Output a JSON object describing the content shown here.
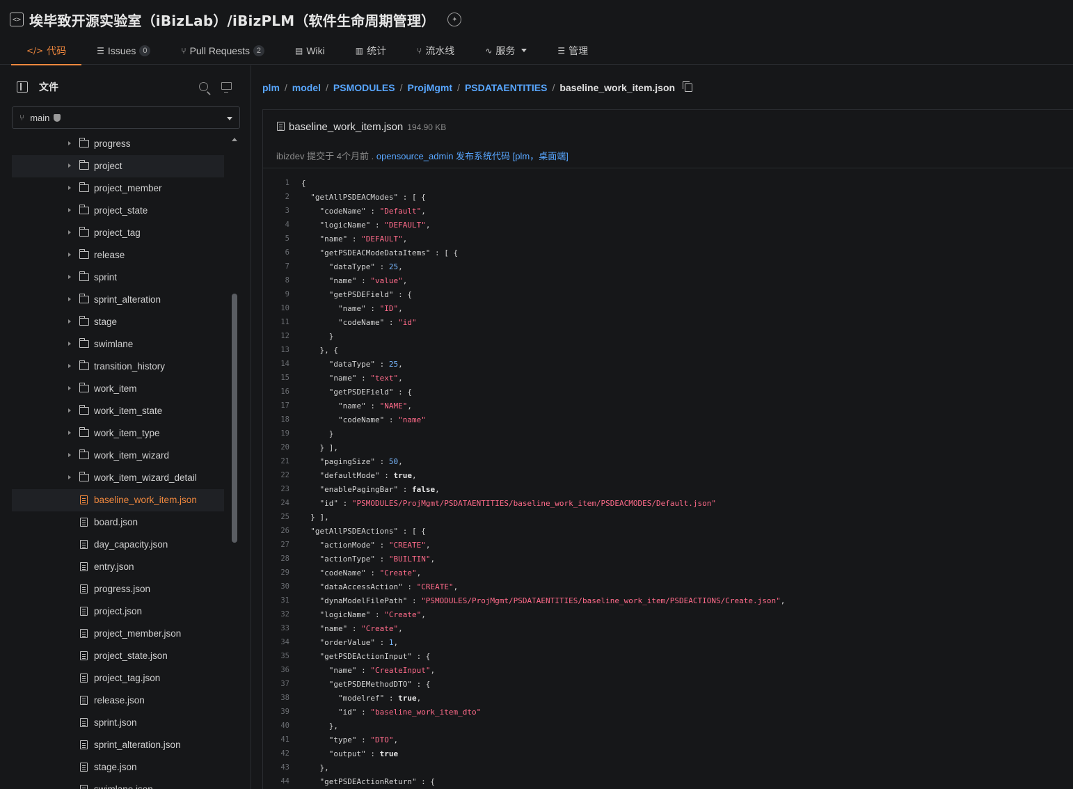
{
  "header": {
    "title": "埃毕致开源实验室（iBizLab）/iBizPLM（软件生命周期管理）",
    "tabs": [
      {
        "icon": "</>",
        "label": "代码",
        "count": ""
      },
      {
        "icon": "☰",
        "label": "Issues",
        "count": "0"
      },
      {
        "icon": "⑂",
        "label": "Pull Requests",
        "count": "2"
      },
      {
        "icon": "▤",
        "label": "Wiki",
        "count": ""
      },
      {
        "icon": "▥",
        "label": "统计",
        "count": ""
      },
      {
        "icon": "⑂",
        "label": "流水线",
        "count": ""
      },
      {
        "icon": "∿",
        "label": "服务",
        "count": ""
      },
      {
        "icon": "☰",
        "label": "管理",
        "count": ""
      }
    ]
  },
  "sidebar": {
    "title": "文件",
    "branch": "main",
    "folders": [
      "progress",
      "project",
      "project_member",
      "project_state",
      "project_tag",
      "release",
      "sprint",
      "sprint_alteration",
      "stage",
      "swimlane",
      "transition_history",
      "work_item",
      "work_item_state",
      "work_item_type",
      "work_item_wizard",
      "work_item_wizard_detail"
    ],
    "files": [
      "baseline_work_item.json",
      "board.json",
      "day_capacity.json",
      "entry.json",
      "progress.json",
      "project.json",
      "project_member.json",
      "project_state.json",
      "project_tag.json",
      "release.json",
      "sprint.json",
      "sprint_alteration.json",
      "stage.json",
      "swimlane.json"
    ]
  },
  "breadcrumb": {
    "parts": [
      "plm",
      "model",
      "PSMODULES",
      "ProjMgmt",
      "PSDATAENTITIES"
    ],
    "current": "baseline_work_item.json"
  },
  "file": {
    "name": "baseline_work_item.json",
    "size": "194.90 KB",
    "commit_author": "ibizdev",
    "commit_verb": "提交于",
    "commit_time": "4个月前",
    "commit_separator": ".",
    "commit_message": "opensource_admin 发布系统代码 [plm，桌面端]"
  },
  "code_lines": [
    [
      [
        "k",
        "{"
      ]
    ],
    [
      [
        "k",
        "  \"getAllPSDEACModes\" : [ {"
      ]
    ],
    [
      [
        "k",
        "    \"codeName\" : "
      ],
      [
        "s",
        "\"Default\""
      ],
      [
        "k",
        ","
      ]
    ],
    [
      [
        "k",
        "    \"logicName\" : "
      ],
      [
        "s",
        "\"DEFAULT\""
      ],
      [
        "k",
        ","
      ]
    ],
    [
      [
        "k",
        "    \"name\" : "
      ],
      [
        "s",
        "\"DEFAULT\""
      ],
      [
        "k",
        ","
      ]
    ],
    [
      [
        "k",
        "    \"getPSDEACModeDataItems\" : [ {"
      ]
    ],
    [
      [
        "k",
        "      \"dataType\" : "
      ],
      [
        "n",
        "25"
      ],
      [
        "k",
        ","
      ]
    ],
    [
      [
        "k",
        "      \"name\" : "
      ],
      [
        "s",
        "\"value\""
      ],
      [
        "k",
        ","
      ]
    ],
    [
      [
        "k",
        "      \"getPSDEField\" : {"
      ]
    ],
    [
      [
        "k",
        "        \"name\" : "
      ],
      [
        "s",
        "\"ID\""
      ],
      [
        "k",
        ","
      ]
    ],
    [
      [
        "k",
        "        \"codeName\" : "
      ],
      [
        "s",
        "\"id\""
      ]
    ],
    [
      [
        "k",
        "      }"
      ]
    ],
    [
      [
        "k",
        "    }, {"
      ]
    ],
    [
      [
        "k",
        "      \"dataType\" : "
      ],
      [
        "n",
        "25"
      ],
      [
        "k",
        ","
      ]
    ],
    [
      [
        "k",
        "      \"name\" : "
      ],
      [
        "s",
        "\"text\""
      ],
      [
        "k",
        ","
      ]
    ],
    [
      [
        "k",
        "      \"getPSDEField\" : {"
      ]
    ],
    [
      [
        "k",
        "        \"name\" : "
      ],
      [
        "s",
        "\"NAME\""
      ],
      [
        "k",
        ","
      ]
    ],
    [
      [
        "k",
        "        \"codeName\" : "
      ],
      [
        "s",
        "\"name\""
      ]
    ],
    [
      [
        "k",
        "      }"
      ]
    ],
    [
      [
        "k",
        "    } ],"
      ]
    ],
    [
      [
        "k",
        "    \"pagingSize\" : "
      ],
      [
        "n",
        "50"
      ],
      [
        "k",
        ","
      ]
    ],
    [
      [
        "k",
        "    \"defaultMode\" : "
      ],
      [
        "b",
        "true"
      ],
      [
        "k",
        ","
      ]
    ],
    [
      [
        "k",
        "    \"enablePagingBar\" : "
      ],
      [
        "b",
        "false"
      ],
      [
        "k",
        ","
      ]
    ],
    [
      [
        "k",
        "    \"id\" : "
      ],
      [
        "s",
        "\"PSMODULES/ProjMgmt/PSDATAENTITIES/baseline_work_item/PSDEACMODES/Default.json\""
      ]
    ],
    [
      [
        "k",
        "  } ],"
      ]
    ],
    [
      [
        "k",
        "  \"getAllPSDEActions\" : [ {"
      ]
    ],
    [
      [
        "k",
        "    \"actionMode\" : "
      ],
      [
        "s",
        "\"CREATE\""
      ],
      [
        "k",
        ","
      ]
    ],
    [
      [
        "k",
        "    \"actionType\" : "
      ],
      [
        "s",
        "\"BUILTIN\""
      ],
      [
        "k",
        ","
      ]
    ],
    [
      [
        "k",
        "    \"codeName\" : "
      ],
      [
        "s",
        "\"Create\""
      ],
      [
        "k",
        ","
      ]
    ],
    [
      [
        "k",
        "    \"dataAccessAction\" : "
      ],
      [
        "s",
        "\"CREATE\""
      ],
      [
        "k",
        ","
      ]
    ],
    [
      [
        "k",
        "    \"dynaModelFilePath\" : "
      ],
      [
        "s",
        "\"PSMODULES/ProjMgmt/PSDATAENTITIES/baseline_work_item/PSDEACTIONS/Create.json\""
      ],
      [
        "k",
        ","
      ]
    ],
    [
      [
        "k",
        "    \"logicName\" : "
      ],
      [
        "s",
        "\"Create\""
      ],
      [
        "k",
        ","
      ]
    ],
    [
      [
        "k",
        "    \"name\" : "
      ],
      [
        "s",
        "\"Create\""
      ],
      [
        "k",
        ","
      ]
    ],
    [
      [
        "k",
        "    \"orderValue\" : "
      ],
      [
        "n",
        "1"
      ],
      [
        "k",
        ","
      ]
    ],
    [
      [
        "k",
        "    \"getPSDEActionInput\" : {"
      ]
    ],
    [
      [
        "k",
        "      \"name\" : "
      ],
      [
        "s",
        "\"CreateInput\""
      ],
      [
        "k",
        ","
      ]
    ],
    [
      [
        "k",
        "      \"getPSDEMethodDTO\" : {"
      ]
    ],
    [
      [
        "k",
        "        \"modelref\" : "
      ],
      [
        "b",
        "true"
      ],
      [
        "k",
        ","
      ]
    ],
    [
      [
        "k",
        "        \"id\" : "
      ],
      [
        "s",
        "\"baseline_work_item_dto\""
      ]
    ],
    [
      [
        "k",
        "      },"
      ]
    ],
    [
      [
        "k",
        "      \"type\" : "
      ],
      [
        "s",
        "\"DTO\""
      ],
      [
        "k",
        ","
      ]
    ],
    [
      [
        "k",
        "      \"output\" : "
      ],
      [
        "b",
        "true"
      ]
    ],
    [
      [
        "k",
        "    },"
      ]
    ],
    [
      [
        "k",
        "    \"getPSDEActionReturn\" : {"
      ]
    ]
  ]
}
